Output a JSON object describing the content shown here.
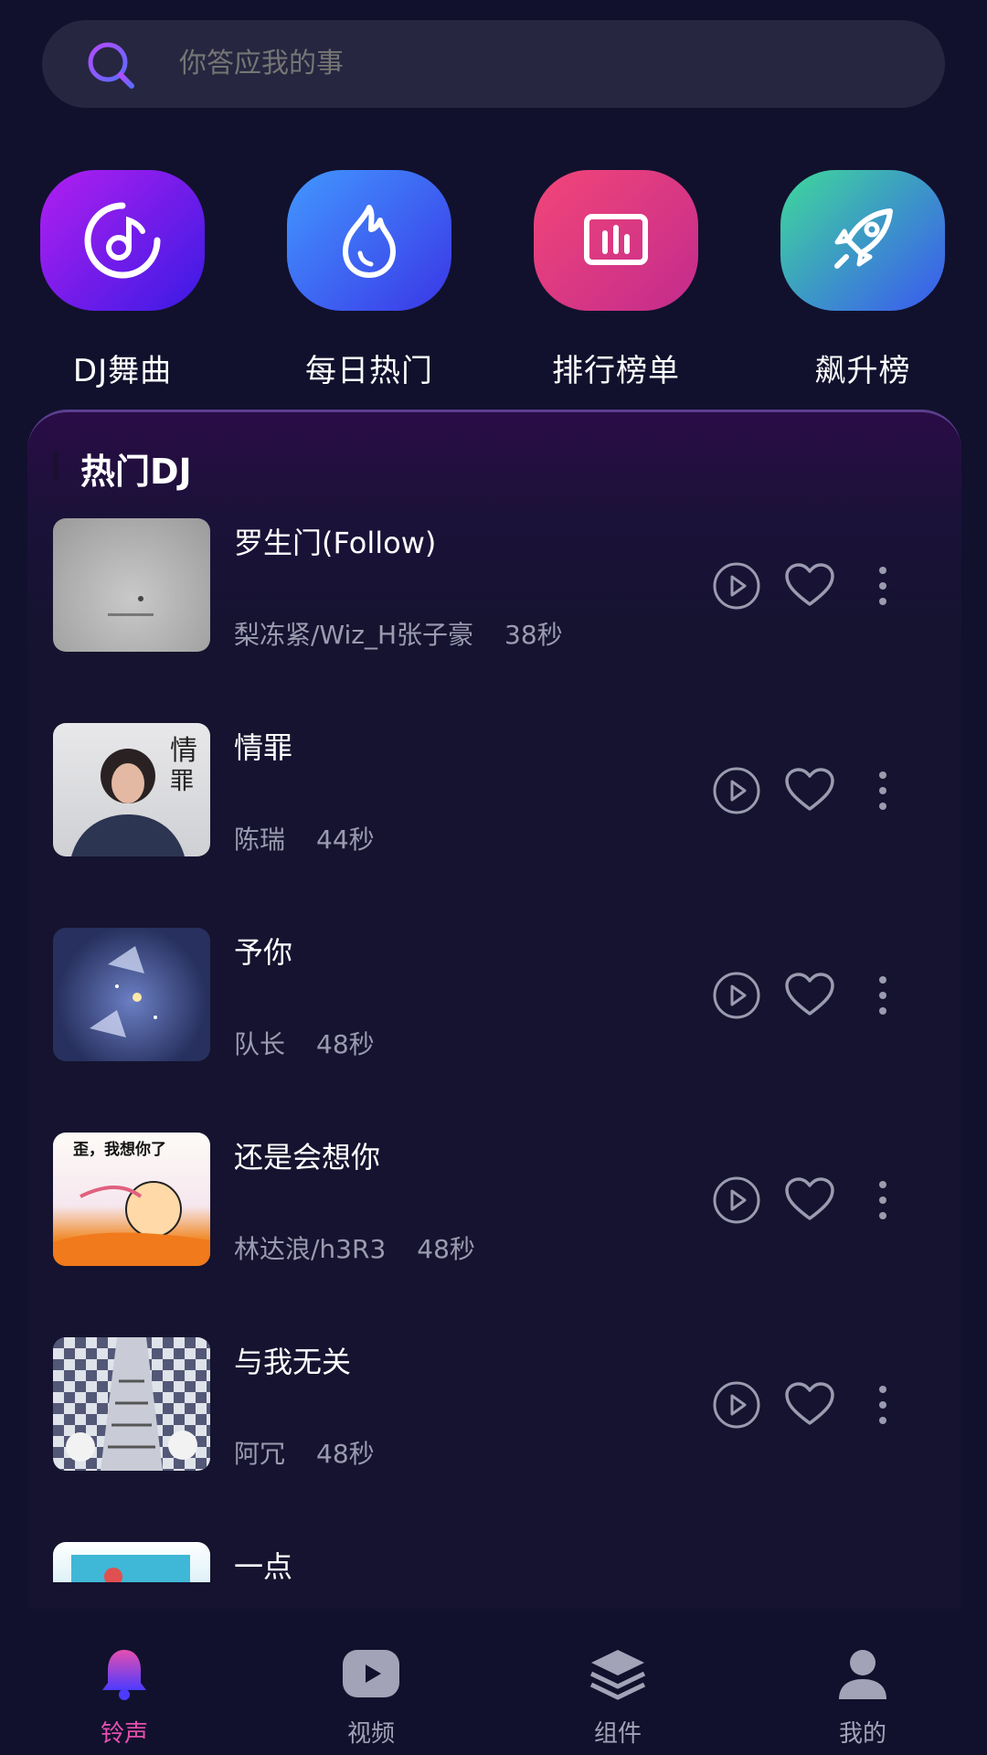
{
  "search": {
    "placeholder": "你答应我的事"
  },
  "categories": [
    {
      "label": "DJ舞曲",
      "icon": "music-disc-icon",
      "color_from": "#a020f0",
      "color_to": "#3b1be0"
    },
    {
      "label": "每日热门",
      "icon": "flame-icon",
      "color_from": "#3f8cff",
      "color_to": "#3a3ae6"
    },
    {
      "label": "排行榜单",
      "icon": "chart-icon",
      "color_from": "#f1447a",
      "color_to": "#c82a88"
    },
    {
      "label": "飙升榜",
      "icon": "rocket-icon",
      "color_from": "#3bd49a",
      "color_to": "#3a5cf0"
    }
  ],
  "panel": {
    "title": "热门DJ"
  },
  "songs": [
    {
      "title": "罗生门(Follow)",
      "artist": "梨冻紧/Wiz_H张子豪",
      "duration": "38秒"
    },
    {
      "title": "情罪",
      "artist": "陈瑞",
      "duration": "44秒"
    },
    {
      "title": "予你",
      "artist": "队长",
      "duration": "48秒"
    },
    {
      "title": "还是会想你",
      "artist": "林达浪/h3R3",
      "duration": "48秒",
      "cover_text": "歪，我想你了"
    },
    {
      "title": "与我无关",
      "artist": "阿冗",
      "duration": "48秒"
    },
    {
      "title": "一点",
      "artist": "",
      "duration": ""
    }
  ],
  "nav": [
    {
      "label": "铃声",
      "icon": "bell-icon",
      "active": true
    },
    {
      "label": "视频",
      "icon": "video-icon",
      "active": false
    },
    {
      "label": "组件",
      "icon": "layers-icon",
      "active": false
    },
    {
      "label": "我的",
      "icon": "user-icon",
      "active": false
    }
  ],
  "colors": {
    "background": "#11112d",
    "accent": "#e64fb0",
    "muted_text": "#9b9bb0"
  }
}
